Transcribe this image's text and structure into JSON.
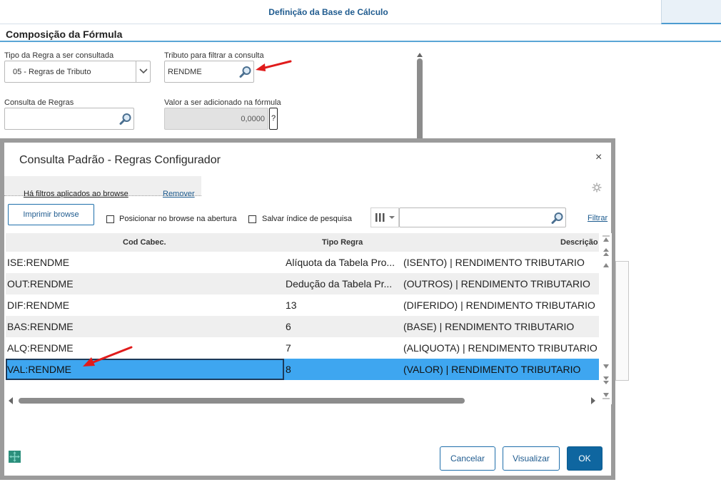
{
  "header": {
    "title": "Definição da Base de Cálculo"
  },
  "section": {
    "title": "Composição da Fórmula"
  },
  "form": {
    "tipo_label": "Tipo da Regra a ser consultada",
    "tipo_value": "05 - Regras de Tributo",
    "tributo_label": "Tributo para filtrar a consulta",
    "tributo_value": "RENDME",
    "consulta_label": "Consulta de Regras",
    "consulta_value": "",
    "valor_label": "Valor a ser adicionado na fórmula",
    "valor_value": "0,0000",
    "help_label": "?"
  },
  "modal": {
    "title": "Consulta Padrão - Regras Configurador",
    "close": "×",
    "filters_text": "Há filtros aplicados ao browse",
    "remove": "Remover",
    "print_button": "Imprimir browse",
    "check1_label": "Posicionar no browse na abertura",
    "check2_label": "Salvar índice de pesquisa",
    "search_placeholder": "",
    "filter_link": "Filtrar",
    "columns": [
      "Cod Cabec.",
      "Tipo Regra",
      "Descrição"
    ],
    "rows": [
      {
        "cod": "ISE:RENDME",
        "tipo": "Alíquota da Tabela Pro...",
        "desc": "(ISENTO) | RENDIMENTO TRIBUTARIO"
      },
      {
        "cod": "OUT:RENDME",
        "tipo": "Dedução da Tabela Pr...",
        "desc": "(OUTROS) | RENDIMENTO TRIBUTARIO"
      },
      {
        "cod": "DIF:RENDME",
        "tipo": "13",
        "desc": "(DIFERIDO) | RENDIMENTO TRIBUTARIO"
      },
      {
        "cod": "BAS:RENDME",
        "tipo": "6",
        "desc": "(BASE) | RENDIMENTO TRIBUTARIO"
      },
      {
        "cod": "ALQ:RENDME",
        "tipo": "7",
        "desc": "(ALIQUOTA) | RENDIMENTO TRIBUTARIO"
      },
      {
        "cod": "VAL:RENDME",
        "tipo": "8",
        "desc": "(VALOR) | RENDIMENTO TRIBUTARIO"
      }
    ],
    "selected_row": 5,
    "buttons": {
      "cancel": "Cancelar",
      "view": "Visualizar",
      "ok": "OK"
    }
  },
  "colors": {
    "accent": "#1f5b8f",
    "selected_row": "#3ea6f0",
    "ok_button": "#0f66a0",
    "annotation_arrow": "#e01b1b"
  }
}
